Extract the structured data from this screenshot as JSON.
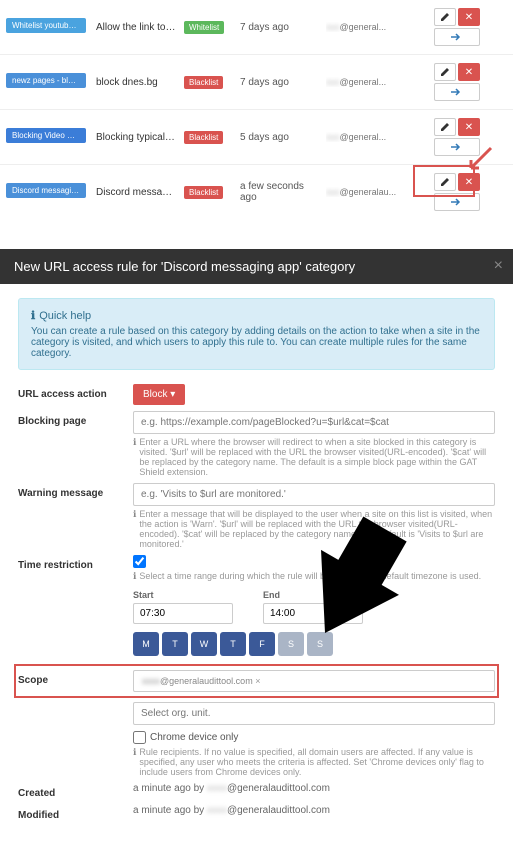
{
  "rules": [
    {
      "category": "Whitelist youtube.com/",
      "catColor": "#4aa3df",
      "desc": "Allow the link to b...",
      "type": "Whitelist",
      "typeClass": "type-whitelist",
      "time": "7 days ago",
      "user": "@general..."
    },
    {
      "category": "newz pages - block",
      "catColor": "#4a90d9",
      "desc": "block dnes.bg",
      "type": "Blacklist",
      "typeClass": "type-blacklist",
      "time": "7 days ago",
      "user": "@general..."
    },
    {
      "category": "Blocking Video Sites",
      "catColor": "#3b7dd8",
      "desc": "Blocking typical vi...",
      "type": "Blacklist",
      "typeClass": "type-blacklist",
      "time": "5 days ago",
      "user": "@general..."
    },
    {
      "category": "Discord messaging ...",
      "catColor": "#4a90d9",
      "desc": "Discord messagi...",
      "type": "Blacklist",
      "typeClass": "type-blacklist",
      "time": "a few seconds ago",
      "user": "@generalau..."
    }
  ],
  "modal": {
    "title": "New URL access rule for 'Discord messaging app' category",
    "help": {
      "title": "Quick help",
      "body": "You can create a rule based on this category by adding details on the action to take when a site in the category is visited, and which users to apply this rule to. You can create multiple rules for the same category."
    },
    "labels": {
      "action": "URL access action",
      "blockingPage": "Blocking page",
      "warning": "Warning message",
      "timeRestriction": "Time restriction",
      "scope": "Scope",
      "created": "Created",
      "modified": "Modified",
      "start": "Start",
      "end": "End",
      "chromeOnly": "Chrome device only"
    },
    "actionButton": "Block",
    "blockingPlaceholder": "e.g. https://example.com/pageBlocked?u=$url&cat=$cat",
    "blockingHint": "Enter a URL where the browser will redirect to when a site blocked in this category is visited. '$url' will be replaced with the URL the browser visited(URL-encoded). '$cat' will be replaced by the category name. The default is a simple block page within the GAT Shield extension.",
    "warningPlaceholder": "e.g. 'Visits to $url are monitored.'",
    "warningHint": "Enter a message that will be displayed to the user when a site on this list is visited, when the action is 'Warn'. '$url' will be replaced with the URL the browser visited(URL-encoded). '$cat' will be replaced by the category name. The default is 'Visits to $url are monitored.'",
    "timeHint": "Select a time range during which the rule will be active. Your default timezone is used.",
    "startTime": "07:30",
    "endTime": "14:00",
    "days": [
      "M",
      "T",
      "W",
      "T",
      "F",
      "S",
      "S"
    ],
    "scopeTag": "@generalaudittool.com",
    "scopePlaceholder": "Select org. unit.",
    "scopeHint": "Rule recipients. If no value is specified, all domain users are affected. If any value is specified, any user who meets the criteria is affected. Set 'Chrome devices only' flag to include users from Chrome devices only.",
    "createdText": "a minute ago by",
    "createdUser": "@generalaudittool.com",
    "modifiedText": "a minute ago by",
    "modifiedUser": "@generalaudittool.com"
  }
}
